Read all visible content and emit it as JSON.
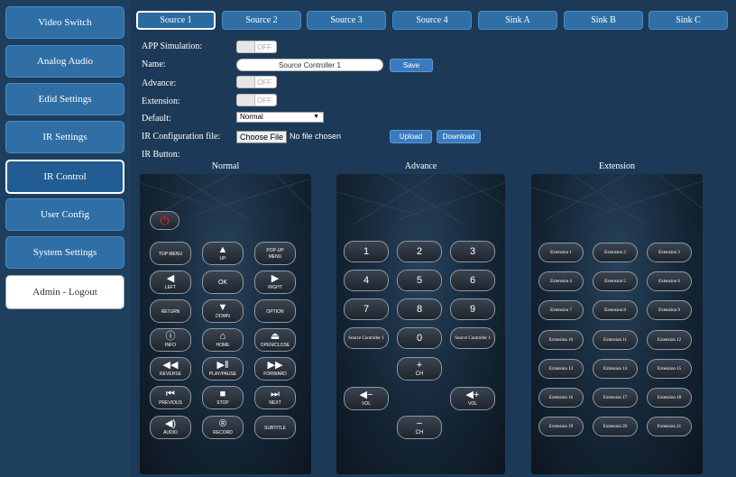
{
  "sidebar": {
    "items": [
      {
        "label": "Video Switch"
      },
      {
        "label": "Analog Audio"
      },
      {
        "label": "Edid Settings"
      },
      {
        "label": "IR Settings"
      },
      {
        "label": "IR Control"
      },
      {
        "label": "User Config"
      },
      {
        "label": "System Settings"
      },
      {
        "label": "Admin - Logout"
      }
    ],
    "selected": "IR Control"
  },
  "tabs": [
    {
      "label": "Source 1"
    },
    {
      "label": "Source 2"
    },
    {
      "label": "Source 3"
    },
    {
      "label": "Source 4"
    },
    {
      "label": "Sink A"
    },
    {
      "label": "Sink B"
    },
    {
      "label": "Sink C"
    }
  ],
  "form": {
    "app_sim_label": "APP Simulation:",
    "app_sim_state": "OFF",
    "name_label": "Name:",
    "name_value": "Source Controller 1",
    "save_label": "Save",
    "advance_label": "Advance:",
    "advance_state": "OFF",
    "extension_label": "Extension:",
    "extension_state": "OFF",
    "default_label": "Default:",
    "default_value": "Normal",
    "ir_config_label": "IR Configuration file:",
    "choose_file": "Choose File",
    "no_file": "No file chosen",
    "upload_label": "Upload",
    "download_label": "Download",
    "ir_button_label": "IR Button:"
  },
  "panels": {
    "normal_title": "Normal",
    "advance_title": "Advance",
    "extension_title": "Extension"
  },
  "normal": {
    "power": {
      "icon": "⏻"
    },
    "top_menu": "TOP MENU",
    "up": "UP",
    "popup1": "POP-UP",
    "popup2": "MENU",
    "left": "LEFT",
    "ok": "OK",
    "right": "RIGHT",
    "return": "RETURN",
    "down": "DOWN",
    "option": "OPTION",
    "info": "INFO",
    "home": "HOME",
    "openclose": "OPEN/CLOSE",
    "reverse": "REVERSE",
    "playpause": "PLAY/PAUSE",
    "forward": "FORWARD",
    "previous": "PREVIOUS",
    "stop": "STOP",
    "next": "NEXT",
    "audio": "AUDIO",
    "record": "RECORD",
    "subtitle": "SUBTITLE"
  },
  "advance": {
    "n1": "1",
    "n2": "2",
    "n3": "3",
    "n4": "4",
    "n5": "5",
    "n6": "6",
    "n7": "7",
    "n8": "8",
    "n9": "9",
    "n0": "0",
    "src_left": "Source Controller 1",
    "src_right": "Source Controller 1",
    "ch": "CH",
    "vol": "VOL"
  },
  "extension": {
    "buttons": [
      "Extension 1",
      "Extension 2",
      "Extension 3",
      "Extension 4",
      "Extension 5",
      "Extension 6",
      "Extension 7",
      "Extension 8",
      "Extension 9",
      "Extension 10",
      "Extension 11",
      "Extension 12",
      "Extension 13",
      "Extension 14",
      "Extension 15",
      "Extension 16",
      "Extension 17",
      "Extension 18",
      "Extension 19",
      "Extension 20",
      "Extension 21"
    ]
  },
  "colors": {
    "background": "#1c3a57",
    "button": "#2f6fa6",
    "power_red": "#e8262b"
  }
}
